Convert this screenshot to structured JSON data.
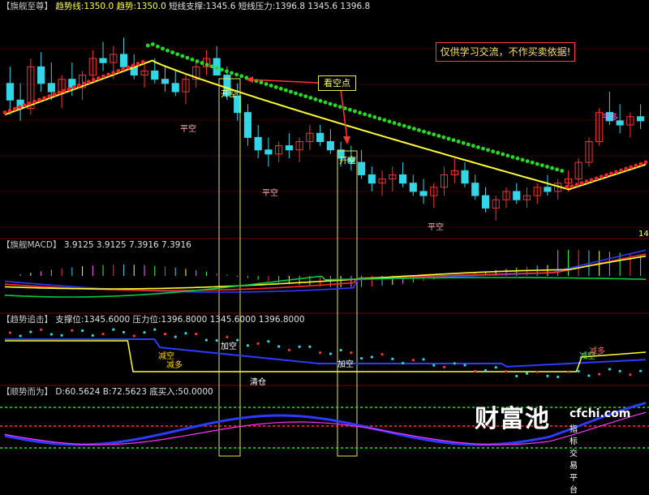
{
  "panels": {
    "main": {
      "tag": "【旗舰至尊】",
      "trend_line_label": "趋势线:1350.0",
      "trend_label": "趋势:1350.0",
      "support_label": "短线支撑:1345.6",
      "pressure_label": "短线压力:1396.8",
      "extra_values": "1345.6 1396.8"
    },
    "macd": {
      "tag": "【旗舰MACD】",
      "values": "3.9125 3.9125 7.3916 7.3916"
    },
    "pursuit": {
      "tag": "【趋势追击】",
      "support_label": "支撑位:1345.6000",
      "pressure_label": "压力位:1396.8000",
      "extra_values": "1345.6000 1396.8000"
    },
    "follow": {
      "tag": "【顺势而为】",
      "values": "D:60.5624 B:72.5623 底买入:50.0000"
    }
  },
  "annotations": {
    "disclaimer": "仅供学习交流，不作买卖依据!",
    "callout": "看空点",
    "open_short": "开空",
    "close_short": "平空",
    "close_long": "平多",
    "add_short": "加空",
    "reduce_short": "减空",
    "reduce_long": "减多",
    "clear_position": "清仓",
    "price_tick": "14"
  },
  "watermark": {
    "brand": "财富池",
    "domain": "cfchi.com",
    "slogan": "指标交易平台"
  },
  "colors": {
    "background": "#000000",
    "up_candle": "#ff3030",
    "down_candle": "#33d6e6",
    "trend_up_dots": "#ff2020",
    "trend_down_dots": "#22dd22",
    "trend_line": "#ffff33",
    "macd_dif": "#ff2a2a",
    "macd_dea": "#2b3bff",
    "macd_signal": "#ffff33",
    "macd_fast": "#00cc44",
    "pane_border": "#7a0000"
  },
  "chart_data": {
    "type": "candlestick",
    "panels": [
      "旗舰至尊",
      "旗舰MACD",
      "趋势追击",
      "顺势而为"
    ],
    "price_reference": {
      "support": 1345.6,
      "pressure": 1396.8,
      "trend": 1350.0
    },
    "candles": [
      [
        0.7,
        0.78,
        0.55,
        0.62
      ],
      [
        0.62,
        0.7,
        0.52,
        0.58
      ],
      [
        0.58,
        0.82,
        0.55,
        0.78
      ],
      [
        0.78,
        0.85,
        0.66,
        0.7
      ],
      [
        0.7,
        0.8,
        0.62,
        0.66
      ],
      [
        0.66,
        0.74,
        0.58,
        0.72
      ],
      [
        0.72,
        0.8,
        0.64,
        0.68
      ],
      [
        0.68,
        0.76,
        0.62,
        0.74
      ],
      [
        0.74,
        0.86,
        0.7,
        0.82
      ],
      [
        0.82,
        0.9,
        0.76,
        0.8
      ],
      [
        0.8,
        0.88,
        0.72,
        0.84
      ],
      [
        0.84,
        0.92,
        0.8,
        0.78
      ],
      [
        0.78,
        0.84,
        0.72,
        0.74
      ],
      [
        0.74,
        0.8,
        0.68,
        0.76
      ],
      [
        0.76,
        0.82,
        0.7,
        0.72
      ],
      [
        0.72,
        0.78,
        0.66,
        0.7
      ],
      [
        0.7,
        0.76,
        0.64,
        0.66
      ],
      [
        0.66,
        0.74,
        0.6,
        0.72
      ],
      [
        0.72,
        0.8,
        0.68,
        0.78
      ],
      [
        0.78,
        0.86,
        0.74,
        0.82
      ],
      [
        0.82,
        0.88,
        0.76,
        0.74
      ],
      [
        0.74,
        0.78,
        0.62,
        0.64
      ],
      [
        0.64,
        0.7,
        0.52,
        0.56
      ],
      [
        0.56,
        0.6,
        0.4,
        0.44
      ],
      [
        0.44,
        0.5,
        0.34,
        0.38
      ],
      [
        0.38,
        0.44,
        0.3,
        0.36
      ],
      [
        0.36,
        0.42,
        0.32,
        0.4
      ],
      [
        0.4,
        0.46,
        0.34,
        0.38
      ],
      [
        0.38,
        0.44,
        0.32,
        0.42
      ],
      [
        0.42,
        0.5,
        0.38,
        0.46
      ],
      [
        0.46,
        0.5,
        0.4,
        0.42
      ],
      [
        0.42,
        0.48,
        0.36,
        0.38
      ],
      [
        0.38,
        0.42,
        0.3,
        0.34
      ],
      [
        0.34,
        0.4,
        0.28,
        0.32
      ],
      [
        0.32,
        0.38,
        0.24,
        0.26
      ],
      [
        0.26,
        0.3,
        0.18,
        0.22
      ],
      [
        0.22,
        0.28,
        0.16,
        0.24
      ],
      [
        0.24,
        0.3,
        0.18,
        0.26
      ],
      [
        0.26,
        0.32,
        0.2,
        0.22
      ],
      [
        0.22,
        0.26,
        0.16,
        0.18
      ],
      [
        0.18,
        0.24,
        0.12,
        0.16
      ],
      [
        0.16,
        0.22,
        0.1,
        0.2
      ],
      [
        0.2,
        0.3,
        0.16,
        0.26
      ],
      [
        0.26,
        0.34,
        0.22,
        0.28
      ],
      [
        0.28,
        0.32,
        0.2,
        0.22
      ],
      [
        0.22,
        0.26,
        0.14,
        0.16
      ],
      [
        0.16,
        0.2,
        0.08,
        0.1
      ],
      [
        0.1,
        0.16,
        0.04,
        0.14
      ],
      [
        0.14,
        0.2,
        0.1,
        0.18
      ],
      [
        0.18,
        0.22,
        0.12,
        0.14
      ],
      [
        0.14,
        0.2,
        0.1,
        0.16
      ],
      [
        0.16,
        0.22,
        0.12,
        0.2
      ],
      [
        0.2,
        0.26,
        0.16,
        0.18
      ],
      [
        0.18,
        0.24,
        0.14,
        0.22
      ],
      [
        0.22,
        0.28,
        0.18,
        0.24
      ],
      [
        0.24,
        0.34,
        0.22,
        0.32
      ],
      [
        0.32,
        0.44,
        0.3,
        0.42
      ],
      [
        0.42,
        0.58,
        0.4,
        0.56
      ],
      [
        0.56,
        0.66,
        0.5,
        0.52
      ],
      [
        0.52,
        0.6,
        0.46,
        0.5
      ],
      [
        0.5,
        0.56,
        0.44,
        0.54
      ],
      [
        0.54,
        0.6,
        0.48,
        0.52
      ]
    ],
    "trend_dots": {
      "green_from": 0.22,
      "green_to": 0.87,
      "red_before": 0.22,
      "red_after": 0.87
    },
    "macd": {
      "zero_line": true,
      "bars": "multi-colored histogram"
    },
    "title": "",
    "xlabel": "",
    "ylabel": ""
  }
}
